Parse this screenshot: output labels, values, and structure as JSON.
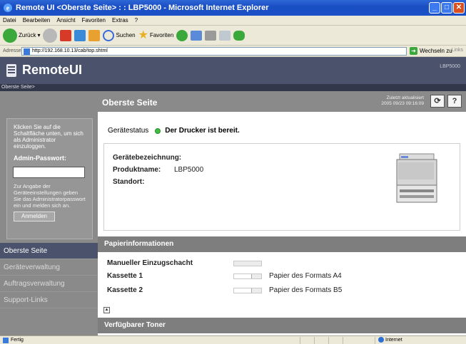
{
  "window": {
    "title": "Remote UI <Oberste Seite> : : LBP5000 - Microsoft Internet Explorer"
  },
  "menu": [
    "Datei",
    "Bearbeiten",
    "Ansicht",
    "Favoriten",
    "Extras",
    "?"
  ],
  "toolbar": {
    "back_label": "Zurück",
    "search_label": "Suchen",
    "favorites_label": "Favoriten"
  },
  "address": {
    "label": "Adresse",
    "url": "http://192.168.10.13/cab/top.shtml",
    "go_label": "Wechseln zu",
    "links_label": "Links"
  },
  "brand": {
    "name": "RemoteUI",
    "model": "LBP5000"
  },
  "breadcrumb": "Oberste Seite>",
  "sidebar": {
    "login_instructions": "Klicken Sie auf die Schaltfläche unten, um sich als Administrator einzuloggen.",
    "password_label": "Admin-Passwort:",
    "note": "Zur Angabe der Geräteeinstellungen geben Sie das Administratorpasswort ein und melden sich an.",
    "login_button": "Anmelden",
    "nav": [
      {
        "label": "Oberste Seite"
      },
      {
        "label": "Geräteverwaltung"
      },
      {
        "label": "Auftragsverwaltung"
      },
      {
        "label": "Support-Links"
      }
    ]
  },
  "content": {
    "title": "Oberste Seite",
    "updated_label": "Zuletzt aktualisiert",
    "updated_value": "2005 09/23 09:16:09",
    "refresh_icon": "refresh-icon",
    "help_label": "?",
    "status_label": "Gerätestatus",
    "status_text": "Der Drucker ist bereit.",
    "status_color": "#3fbf3f",
    "device": {
      "name_label": "Gerätebezeichnung:",
      "name_value": "",
      "product_label": "Produktname:",
      "product_value": "LBP5000",
      "location_label": "Standort:",
      "location_value": ""
    },
    "paper_section": "Papierinformationen",
    "paper": [
      {
        "label": "Manueller Einzugschacht",
        "value": "",
        "level": 0
      },
      {
        "label": "Kassette 1",
        "value": "Papier des Formats A4",
        "level": 0.65
      },
      {
        "label": "Kassette 2",
        "value": "Papier des Formats B5",
        "level": 0.65
      }
    ],
    "up_label": "▲",
    "toner_section": "Verfügbarer Toner"
  },
  "statusbar": {
    "left": "Fertig",
    "zone": "Internet"
  }
}
